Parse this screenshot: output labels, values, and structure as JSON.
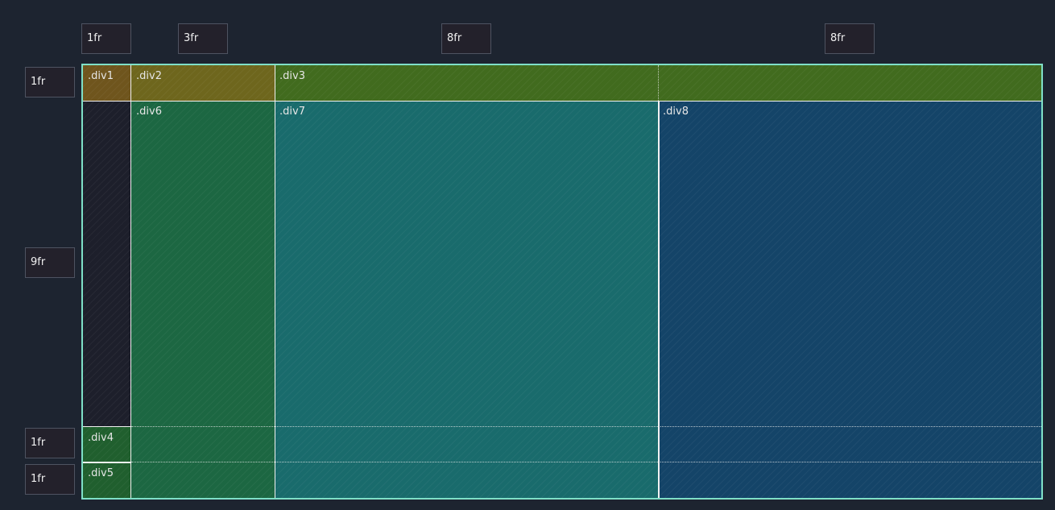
{
  "columns": [
    "1fr",
    "3fr",
    "8fr",
    "8fr"
  ],
  "rows": [
    "1fr",
    "9fr",
    "1fr",
    "1fr"
  ],
  "cells": {
    "div1": ".div1",
    "div2": ".div2",
    "div3": ".div3",
    "div4": ".div4",
    "div5": ".div5",
    "div6": ".div6",
    "div7": ".div7",
    "div8": ".div8"
  },
  "colors": {
    "background": "#1d2430",
    "grid_border": "#7fe0c8",
    "div1": "#6f551d",
    "div2": "#6e661d",
    "div3": "#416b1e",
    "div4": "#205f2e",
    "div5": "#205f2e",
    "div6": "#1c6742",
    "div7": "#196b6c",
    "div8": "#144468",
    "empty": "#1d1f2b"
  }
}
